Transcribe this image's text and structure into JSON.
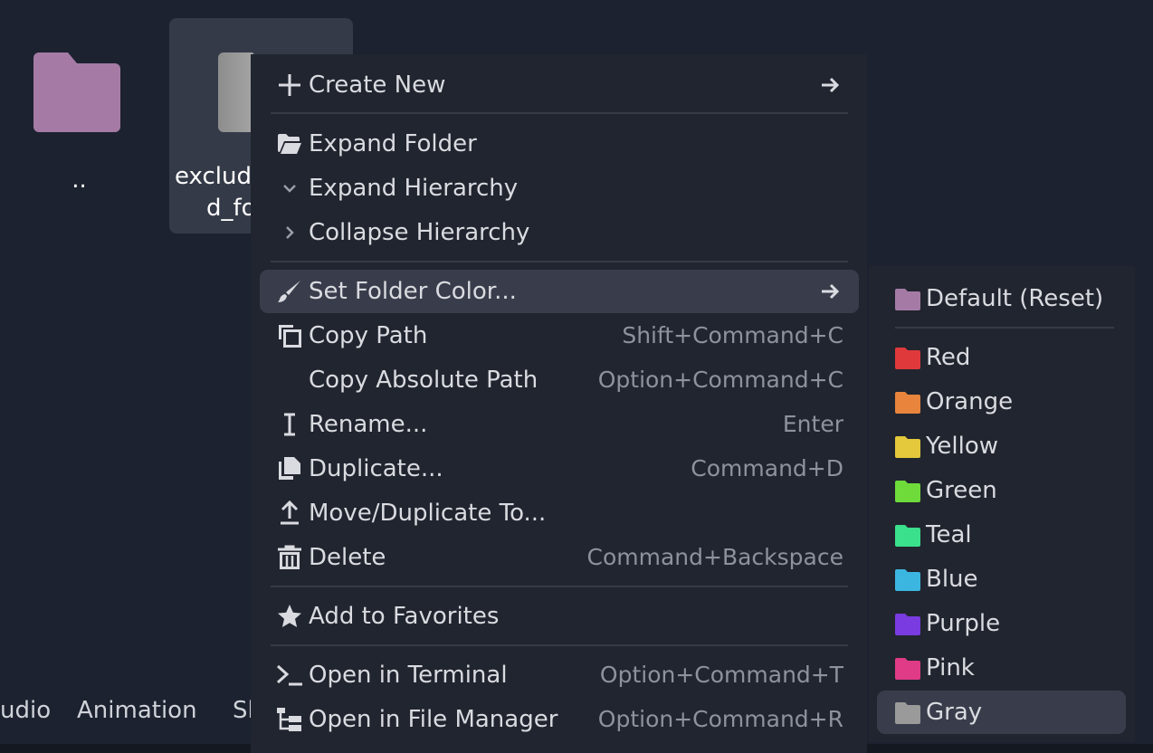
{
  "files": [
    {
      "label": "..",
      "color": "#a57ba6"
    },
    {
      "label_line1": "exclud",
      "label_line2": "d_fo",
      "color": "#9a9a9a"
    }
  ],
  "bottom_tabs": [
    {
      "label": "udio"
    },
    {
      "label": "Animation"
    },
    {
      "label": "Sl"
    }
  ],
  "menu": {
    "create_new": {
      "label": "Create New",
      "icon": "plus-icon"
    },
    "expand_folder": {
      "label": "Expand Folder",
      "icon": "folder-open-icon"
    },
    "expand_hierarchy": {
      "label": "Expand Hierarchy",
      "icon": "chevron-down-icon"
    },
    "collapse_hierarchy": {
      "label": "Collapse Hierarchy",
      "icon": "chevron-right-icon"
    },
    "set_folder_color": {
      "label": "Set Folder Color...",
      "icon": "brush-icon"
    },
    "copy_path": {
      "label": "Copy Path",
      "shortcut": "Shift+Command+C",
      "icon": "copy-icon"
    },
    "copy_absolute_path": {
      "label": "Copy Absolute Path",
      "shortcut": "Option+Command+C"
    },
    "rename": {
      "label": "Rename...",
      "shortcut": "Enter",
      "icon": "text-cursor-icon"
    },
    "duplicate": {
      "label": "Duplicate...",
      "shortcut": "Command+D",
      "icon": "duplicate-icon"
    },
    "move_duplicate_to": {
      "label": "Move/Duplicate To...",
      "icon": "move-up-icon"
    },
    "delete": {
      "label": "Delete",
      "shortcut": "Command+Backspace",
      "icon": "trash-icon"
    },
    "add_to_favorites": {
      "label": "Add to Favorites",
      "icon": "star-icon"
    },
    "open_in_terminal": {
      "label": "Open in Terminal",
      "shortcut": "Option+Command+T",
      "icon": "terminal-icon"
    },
    "open_in_file_manager": {
      "label": "Open in File Manager",
      "shortcut": "Option+Command+R",
      "icon": "file-tree-icon"
    }
  },
  "submenu": {
    "default": {
      "label": "Default (Reset)",
      "color": "#a57ba6"
    },
    "colors": [
      {
        "label": "Red",
        "color": "#e0393b"
      },
      {
        "label": "Orange",
        "color": "#e8843b"
      },
      {
        "label": "Yellow",
        "color": "#e3c93b"
      },
      {
        "label": "Green",
        "color": "#6edb3b"
      },
      {
        "label": "Teal",
        "color": "#3be08c"
      },
      {
        "label": "Blue",
        "color": "#3bb6e0"
      },
      {
        "label": "Purple",
        "color": "#7a3be0"
      },
      {
        "label": "Pink",
        "color": "#e03b86"
      },
      {
        "label": "Gray",
        "color": "#9a9a9a"
      }
    ]
  },
  "colors": {
    "icon": "#d9dbe0",
    "hover_bg": "#393d4b",
    "menu_bg": "#21252f"
  }
}
